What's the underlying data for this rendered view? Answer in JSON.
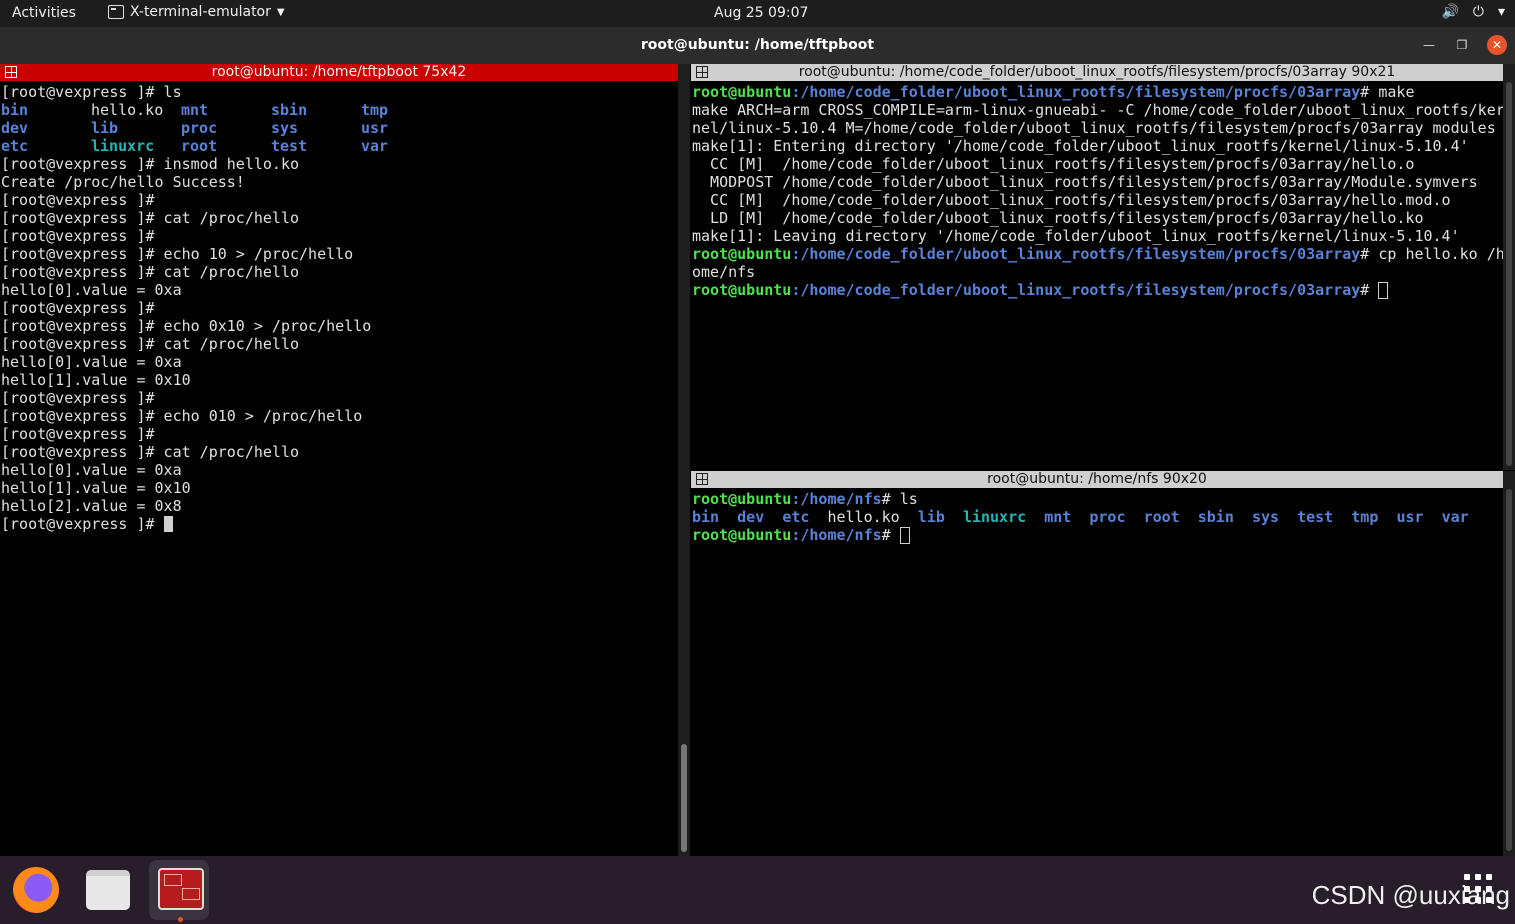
{
  "topbar": {
    "activities": "Activities",
    "app_name": "X-terminal-emulator",
    "clock": "Aug 25  09:07",
    "tray_icons": [
      "volume-icon",
      "power-icon",
      "chevron-down-icon"
    ]
  },
  "window": {
    "title": "root@ubuntu: /home/tftpboot"
  },
  "left_pane": {
    "title": "root@ubuntu: /home/tftpboot 75x42",
    "prompt": "[root@vexpress ]# ",
    "lines": [
      "[root@vexpress ]# ls",
      "__LSGRID__",
      "[root@vexpress ]# insmod hello.ko",
      "Create /proc/hello Success!",
      "[root@vexpress ]#",
      "[root@vexpress ]# cat /proc/hello",
      "[root@vexpress ]#",
      "[root@vexpress ]# echo 10 > /proc/hello",
      "[root@vexpress ]# cat /proc/hello",
      "hello[0].value = 0xa",
      "[root@vexpress ]#",
      "[root@vexpress ]# echo 0x10 > /proc/hello",
      "[root@vexpress ]# cat /proc/hello",
      "hello[0].value = 0xa",
      "hello[1].value = 0x10",
      "[root@vexpress ]#",
      "[root@vexpress ]# echo 010 > /proc/hello",
      "[root@vexpress ]#",
      "[root@vexpress ]# cat /proc/hello",
      "hello[0].value = 0xa",
      "hello[1].value = 0x10",
      "hello[2].value = 0x8"
    ],
    "ls_rows": [
      [
        {
          "t": "bin",
          "c": "dir"
        },
        {
          "t": "hello.ko",
          "c": ""
        },
        {
          "t": "mnt",
          "c": "dir"
        },
        {
          "t": "sbin",
          "c": "dir"
        },
        {
          "t": "tmp",
          "c": "dir"
        }
      ],
      [
        {
          "t": "dev",
          "c": "dir"
        },
        {
          "t": "lib",
          "c": "dir"
        },
        {
          "t": "proc",
          "c": "dir"
        },
        {
          "t": "sys",
          "c": "dir"
        },
        {
          "t": "usr",
          "c": "dir"
        }
      ],
      [
        {
          "t": "etc",
          "c": "dir"
        },
        {
          "t": "linuxrc",
          "c": "lnk"
        },
        {
          "t": "root",
          "c": "dir"
        },
        {
          "t": "test",
          "c": "dir"
        },
        {
          "t": "var",
          "c": "dir"
        }
      ]
    ]
  },
  "top_right_pane": {
    "title": "root@ubuntu: /home/code_folder/uboot_linux_rootfs/filesystem/procfs/03array 90x21",
    "prompt_user": "root@ubuntu",
    "prompt_path": ":/home/code_folder/uboot_linux_rootfs/filesystem/procfs/03array",
    "lines": [
      {
        "type": "prompt",
        "cmd": "# make"
      },
      {
        "type": "text",
        "text": "make ARCH=arm CROSS_COMPILE=arm-linux-gnueabi- -C /home/code_folder/uboot_linux_rootfs/ker"
      },
      {
        "type": "text",
        "text": "nel/linux-5.10.4 M=/home/code_folder/uboot_linux_rootfs/filesystem/procfs/03array modules"
      },
      {
        "type": "text",
        "text": "make[1]: Entering directory '/home/code_folder/uboot_linux_rootfs/kernel/linux-5.10.4'"
      },
      {
        "type": "text",
        "text": "  CC [M]  /home/code_folder/uboot_linux_rootfs/filesystem/procfs/03array/hello.o"
      },
      {
        "type": "text",
        "text": "  MODPOST /home/code_folder/uboot_linux_rootfs/filesystem/procfs/03array/Module.symvers"
      },
      {
        "type": "text",
        "text": "  CC [M]  /home/code_folder/uboot_linux_rootfs/filesystem/procfs/03array/hello.mod.o"
      },
      {
        "type": "text",
        "text": "  LD [M]  /home/code_folder/uboot_linux_rootfs/filesystem/procfs/03array/hello.ko"
      },
      {
        "type": "text",
        "text": "make[1]: Leaving directory '/home/code_folder/uboot_linux_rootfs/kernel/linux-5.10.4'"
      },
      {
        "type": "prompt",
        "cmd": "# cp hello.ko /h"
      },
      {
        "type": "text",
        "text": "ome/nfs"
      },
      {
        "type": "prompt",
        "cmd": "# ",
        "cursor": true
      }
    ]
  },
  "bottom_right_pane": {
    "title": "root@ubuntu: /home/nfs 90x20",
    "prompt_user": "root@ubuntu",
    "prompt_path": ":/home/nfs",
    "cmd": "# ls",
    "ls_items": [
      {
        "t": "bin",
        "c": "dir"
      },
      {
        "t": "dev",
        "c": "dir"
      },
      {
        "t": "etc",
        "c": "dir"
      },
      {
        "t": "hello.ko",
        "c": ""
      },
      {
        "t": "lib",
        "c": "dir"
      },
      {
        "t": "linuxrc",
        "c": "lnk"
      },
      {
        "t": "mnt",
        "c": "dir"
      },
      {
        "t": "proc",
        "c": "dir"
      },
      {
        "t": "root",
        "c": "dir"
      },
      {
        "t": "sbin",
        "c": "dir"
      },
      {
        "t": "sys",
        "c": "dir"
      },
      {
        "t": "test",
        "c": "dir"
      },
      {
        "t": "tmp",
        "c": "dir"
      },
      {
        "t": "usr",
        "c": "dir"
      },
      {
        "t": "var",
        "c": "dir"
      }
    ],
    "prompt_end": "# "
  },
  "dock": {
    "items": [
      "firefox-icon",
      "files-icon",
      "terminal-icon"
    ],
    "watermark": "CSDN @uuxiang"
  },
  "colors": {
    "left_title_bg": "#c90000",
    "prompt_green": "#4ee04e",
    "path_blue": "#5a82d6",
    "dir_blue": "#5a82d6",
    "link_cyan": "#25b5b5",
    "dock_bg": "#281d2a"
  }
}
